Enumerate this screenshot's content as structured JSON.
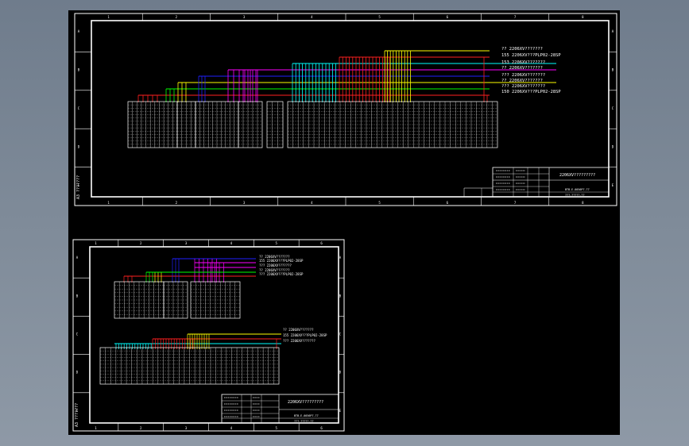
{
  "sheet1": {
    "labels": [
      "??  2206XV???????",
      "155  2206XV???PLP02-28SP",
      "153  2206XV???????",
      "??  2206XV???????",
      "???  2206XV???????",
      "??  2206XV???????",
      "???  2206XV???????",
      "150  2206XV???PLP02-28SP"
    ],
    "title_block": {
      "title": "2206XV?????????",
      "drawing_no": "BTB-E-0056P7-77",
      "sheet": "???-?????-??"
    },
    "border_numbers": [
      "1",
      "2",
      "3",
      "4",
      "5",
      "6",
      "7",
      "8"
    ],
    "border_letters": [
      "A",
      "B",
      "C",
      "D",
      "E"
    ],
    "side_text": "A3  ???????"
  },
  "sheet2": {
    "labels_top": [
      "??  2206XV???????",
      "155  2206XV???PLP02-28SP",
      "???  2206XV???????",
      "??  2206XV???????",
      "???  2206XV???PLP02-28SP"
    ],
    "labels_bottom": [
      "??  2206XV???????",
      "155  2206XV???PLP02-28SP",
      "???  2206XV???????"
    ],
    "title_block": {
      "title": "2206XV?????????",
      "drawing_no": "BTB-E-0056P7-77",
      "sheet": "???-?????-??"
    },
    "border_numbers": [
      "1",
      "2",
      "3",
      "4",
      "5",
      "6"
    ],
    "border_letters": [
      "A",
      "B",
      "C",
      "D",
      "E"
    ],
    "side_text": "A3  ???????"
  },
  "colors": {
    "yellow": "#ffff00",
    "cyan": "#00ffff",
    "magenta": "#ff00ff",
    "red": "#ff2020",
    "green": "#00ff00",
    "blue": "#2020ff",
    "white": "#ffffff",
    "background": "#000000"
  }
}
